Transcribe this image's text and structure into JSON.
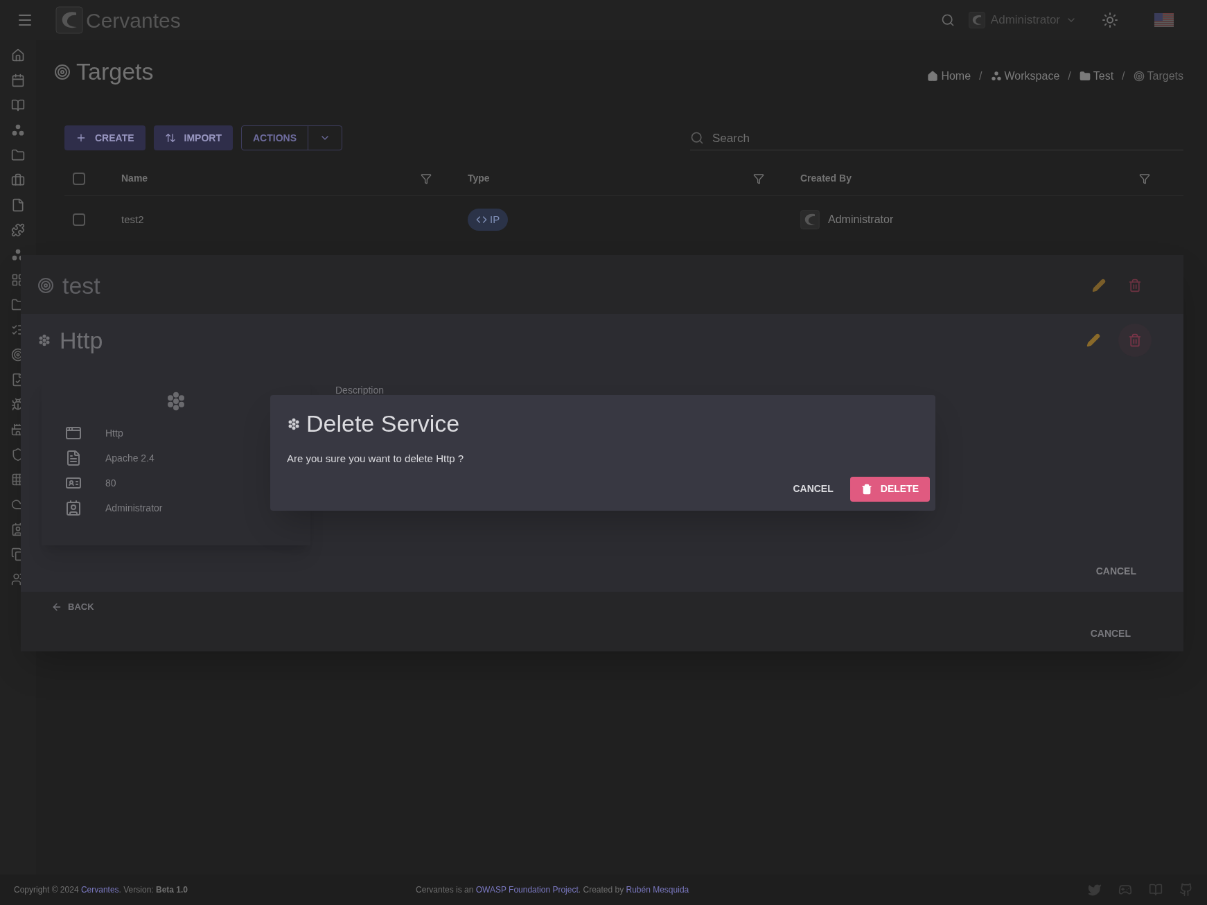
{
  "topbar": {
    "app_name": "Cervantes",
    "user": "Administrator"
  },
  "page": {
    "title": "Targets",
    "separator": "/",
    "breadcrumbs": [
      {
        "label": "Home",
        "kind": "home",
        "current": false
      },
      {
        "label": "Workspace",
        "kind": "workspace",
        "current": false
      },
      {
        "label": "Test",
        "kind": "folder",
        "current": false
      },
      {
        "label": "Targets",
        "kind": "target",
        "current": true
      }
    ]
  },
  "toolbar": {
    "buttons": [
      {
        "label": "CREATE",
        "kind": "create"
      },
      {
        "label": "IMPORT",
        "kind": "import"
      },
      {
        "label": "ACTIONS",
        "kind": "split"
      }
    ],
    "search": {
      "placeholder": "Search"
    }
  },
  "table": {
    "all_checked": false,
    "columns": [
      "Name",
      "Type",
      "Created By"
    ],
    "rows": [
      {
        "checked": false,
        "name": "test2",
        "type": "IP",
        "created_by": "Administrator"
      }
    ]
  },
  "target_dialog": {
    "title": "test",
    "back": "BACK",
    "cancel": "CANCEL"
  },
  "service_dialog": {
    "title": "Http",
    "details": [
      {
        "kind": "name",
        "text": "Http"
      },
      {
        "kind": "version",
        "text": "Apache 2.4"
      },
      {
        "kind": "port",
        "text": "80"
      },
      {
        "kind": "owner",
        "text": "Administrator"
      }
    ],
    "description_label": "Description",
    "cancel": "CANCEL"
  },
  "confirm_dialog": {
    "title": "Delete Service",
    "message": "Are you sure you want to delete Http ?",
    "buttons": [
      {
        "label": "CANCEL",
        "kind": "text"
      },
      {
        "label": "DELETE",
        "kind": "danger"
      }
    ]
  },
  "footer": {
    "copyright": "Copyright © 2024 ",
    "copyright_link": "Cervantes",
    "version_prefix": ". Version: ",
    "version": "Beta 1.0",
    "about_prefix": "Cervantes is an ",
    "about_link": "OWASP Foundation Project",
    "about_mid": ". Created by ",
    "author_link": "Rubén Mesquida"
  }
}
